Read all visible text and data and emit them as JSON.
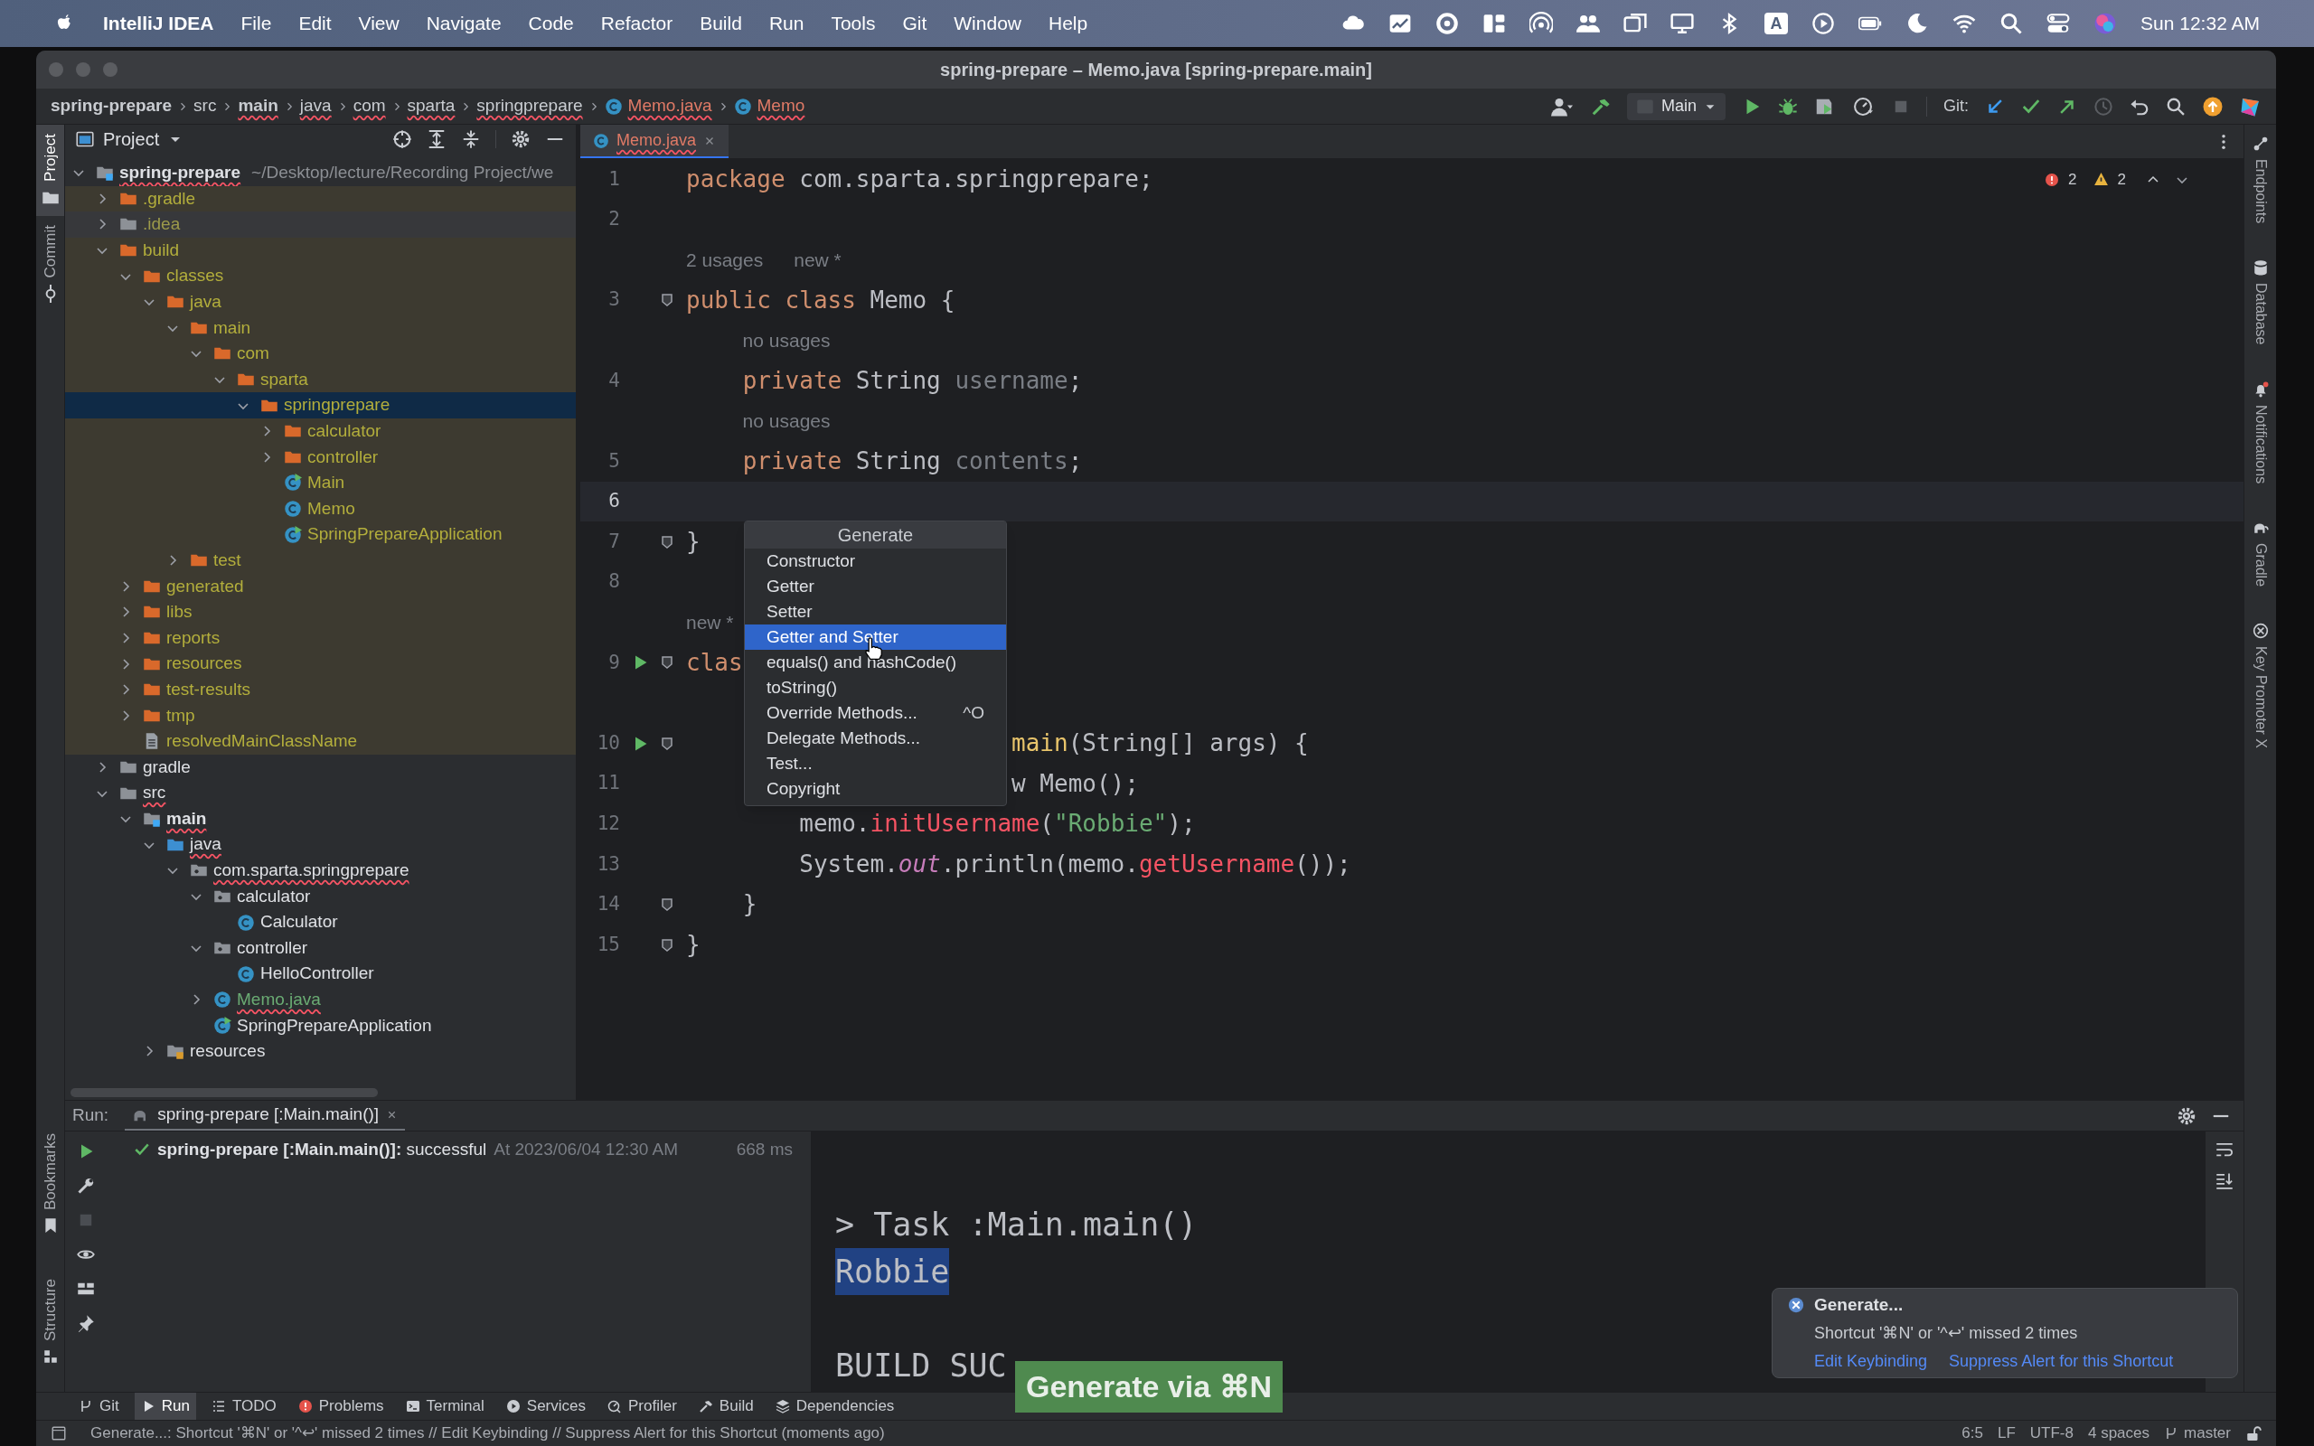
{
  "menubar": {
    "app": "IntelliJ IDEA",
    "menus": [
      "File",
      "Edit",
      "View",
      "Navigate",
      "Code",
      "Refactor",
      "Build",
      "Run",
      "Tools",
      "Git",
      "Window",
      "Help"
    ],
    "input_source": "A",
    "clock": "Sun 12:32 AM"
  },
  "window": {
    "title": "spring-prepare – Memo.java [spring-prepare.main]"
  },
  "breadcrumbs": [
    {
      "label": "spring-prepare",
      "kind": "folder",
      "bold": true,
      "error": false
    },
    {
      "label": "src",
      "kind": "folder",
      "bold": false,
      "error": false
    },
    {
      "label": "main",
      "kind": "folder",
      "bold": true,
      "error": true
    },
    {
      "label": "java",
      "kind": "folder",
      "bold": false,
      "error": true
    },
    {
      "label": "com",
      "kind": "folder",
      "bold": false,
      "error": true
    },
    {
      "label": "sparta",
      "kind": "folder",
      "bold": false,
      "error": true
    },
    {
      "label": "springprepare",
      "kind": "folder",
      "bold": false,
      "error": true
    },
    {
      "label": "Memo.java",
      "kind": "class",
      "bold": false,
      "error": true
    },
    {
      "label": "Memo",
      "kind": "class",
      "bold": false,
      "error": true
    }
  ],
  "toolbar": {
    "run_config": "Main",
    "git_label": "Git:"
  },
  "left_stripe": {
    "top": [
      {
        "label": "Project",
        "selected": true
      },
      {
        "label": "Commit",
        "selected": false
      }
    ],
    "bottom": [
      {
        "label": "Bookmarks",
        "selected": false
      },
      {
        "label": "Structure",
        "selected": false
      }
    ]
  },
  "right_stripe": [
    {
      "label": "Endpoints"
    },
    {
      "label": "Database"
    },
    {
      "label": "Notifications"
    },
    {
      "label": "Gradle"
    },
    {
      "label": "Key Promoter X"
    }
  ],
  "project": {
    "title": "Project",
    "tree": [
      {
        "label": "spring-prepare",
        "path": "~/Desktop/lecture/Recording Project/we",
        "kind": "module",
        "excluded": false,
        "expanded": true,
        "selected": false,
        "error": true,
        "children": [
          {
            "label": ".gradle",
            "kind": "folder",
            "excluded": true,
            "expanded": false,
            "selected": false,
            "error": false
          },
          {
            "label": ".idea",
            "kind": "config-folder",
            "excluded": true,
            "expanded": false,
            "selected": false,
            "error": false
          },
          {
            "label": "build",
            "kind": "folder",
            "excluded": true,
            "expanded": true,
            "selected": false,
            "error": false,
            "children": [
              {
                "label": "classes",
                "kind": "folder",
                "excluded": true,
                "expanded": true,
                "selected": false,
                "error": false,
                "children": [
                  {
                    "label": "java",
                    "kind": "folder",
                    "excluded": true,
                    "expanded": true,
                    "selected": false,
                    "error": false,
                    "children": [
                      {
                        "label": "main",
                        "kind": "folder",
                        "excluded": true,
                        "expanded": true,
                        "selected": false,
                        "error": false,
                        "children": [
                          {
                            "label": "com",
                            "kind": "folder",
                            "excluded": true,
                            "expanded": true,
                            "selected": false,
                            "error": false,
                            "children": [
                              {
                                "label": "sparta",
                                "kind": "folder",
                                "excluded": true,
                                "expanded": true,
                                "selected": false,
                                "error": false,
                                "children": [
                                  {
                                    "label": "springprepare",
                                    "kind": "folder",
                                    "excluded": true,
                                    "expanded": true,
                                    "selected": true,
                                    "error": false,
                                    "children": [
                                      {
                                        "label": "calculator",
                                        "kind": "folder",
                                        "excluded": true,
                                        "expanded": false,
                                        "selected": false,
                                        "error": false
                                      },
                                      {
                                        "label": "controller",
                                        "kind": "folder",
                                        "excluded": true,
                                        "expanded": false,
                                        "selected": false,
                                        "error": false
                                      },
                                      {
                                        "label": "Main",
                                        "kind": "class-run",
                                        "excluded": true,
                                        "selected": false,
                                        "error": false
                                      },
                                      {
                                        "label": "Memo",
                                        "kind": "class",
                                        "excluded": true,
                                        "selected": false,
                                        "error": false
                                      },
                                      {
                                        "label": "SpringPrepareApplication",
                                        "kind": "class-run",
                                        "excluded": true,
                                        "selected": false,
                                        "error": false
                                      }
                                    ]
                                  }
                                ]
                              }
                            ]
                          }
                        ]
                      },
                      {
                        "label": "test",
                        "kind": "folder",
                        "excluded": true,
                        "expanded": false,
                        "selected": false,
                        "error": false
                      }
                    ]
                  }
                ]
              },
              {
                "label": "generated",
                "kind": "folder",
                "excluded": true,
                "expanded": false,
                "selected": false,
                "error": false
              },
              {
                "label": "libs",
                "kind": "folder",
                "excluded": true,
                "expanded": false,
                "selected": false,
                "error": false
              },
              {
                "label": "reports",
                "kind": "folder",
                "excluded": true,
                "expanded": false,
                "selected": false,
                "error": false
              },
              {
                "label": "resources",
                "kind": "folder",
                "excluded": true,
                "expanded": false,
                "selected": false,
                "error": false
              },
              {
                "label": "test-results",
                "kind": "folder",
                "excluded": true,
                "expanded": false,
                "selected": false,
                "error": false
              },
              {
                "label": "tmp",
                "kind": "folder",
                "excluded": true,
                "expanded": false,
                "selected": false,
                "error": false
              },
              {
                "label": "resolvedMainClassName",
                "kind": "file",
                "excluded": true,
                "selected": false,
                "error": false
              }
            ]
          },
          {
            "label": "gradle",
            "kind": "folder",
            "excluded": false,
            "expanded": false,
            "selected": false,
            "error": false
          },
          {
            "label": "src",
            "kind": "folder",
            "excluded": false,
            "expanded": true,
            "selected": false,
            "error": true,
            "children": [
              {
                "label": "main",
                "kind": "module",
                "excluded": false,
                "expanded": true,
                "selected": false,
                "error": true,
                "children": [
                  {
                    "label": "java",
                    "kind": "source-root",
                    "excluded": false,
                    "expanded": true,
                    "selected": false,
                    "error": true,
                    "children": [
                      {
                        "label": "com.sparta.springprepare",
                        "kind": "package",
                        "excluded": false,
                        "expanded": true,
                        "selected": false,
                        "error": true,
                        "children": [
                          {
                            "label": "calculator",
                            "kind": "package",
                            "excluded": false,
                            "expanded": true,
                            "selected": false,
                            "error": false,
                            "children": [
                              {
                                "label": "Calculator",
                                "kind": "class",
                                "excluded": false,
                                "selected": false,
                                "error": false
                              }
                            ]
                          },
                          {
                            "label": "controller",
                            "kind": "package",
                            "excluded": false,
                            "expanded": true,
                            "selected": false,
                            "error": false,
                            "children": [
                              {
                                "label": "HelloController",
                                "kind": "class",
                                "excluded": false,
                                "selected": false,
                                "error": false
                              }
                            ]
                          },
                          {
                            "label": "Memo.java",
                            "kind": "modified-class",
                            "excluded": false,
                            "expanded": false,
                            "selected": false,
                            "error": true
                          },
                          {
                            "label": "SpringPrepareApplication",
                            "kind": "class-run",
                            "excluded": false,
                            "selected": false,
                            "error": false
                          }
                        ]
                      }
                    ]
                  },
                  {
                    "label": "resources",
                    "kind": "resources-root",
                    "excluded": false,
                    "expanded": false,
                    "selected": false,
                    "error": false
                  }
                ]
              }
            ]
          }
        ]
      }
    ]
  },
  "editor": {
    "tab": {
      "label": "Memo.java",
      "error": true
    },
    "problems": {
      "errors": "2",
      "warnings": "2"
    },
    "rows": [
      {
        "kind": "code",
        "number": "1",
        "run": false,
        "fold": false,
        "current": false,
        "tokens": [
          {
            "t": "package",
            "kind": "keyword"
          },
          {
            "t": " com.sparta.springprepare;",
            "kind": "plain"
          }
        ]
      },
      {
        "kind": "code",
        "number": "2",
        "run": false,
        "fold": false,
        "current": false,
        "tokens": []
      },
      {
        "kind": "hint",
        "parts": [
          "2 usages",
          "new *"
        ]
      },
      {
        "kind": "code",
        "number": "3",
        "run": false,
        "fold": true,
        "current": false,
        "tokens": [
          {
            "t": "public class",
            "kind": "keyword"
          },
          {
            "t": " Memo {",
            "kind": "plain"
          }
        ]
      },
      {
        "kind": "hint",
        "parts": [
          "no usages"
        ]
      },
      {
        "kind": "code",
        "number": "4",
        "run": false,
        "fold": false,
        "current": false,
        "tokens": [
          {
            "t": "    private",
            "kind": "keyword"
          },
          {
            "t": " String ",
            "kind": "plain"
          },
          {
            "t": "username",
            "kind": "unused"
          },
          {
            "t": ";",
            "kind": "plain"
          }
        ]
      },
      {
        "kind": "hint",
        "parts": [
          "no usages"
        ]
      },
      {
        "kind": "code",
        "number": "5",
        "run": false,
        "fold": false,
        "current": false,
        "tokens": [
          {
            "t": "    private",
            "kind": "keyword"
          },
          {
            "t": " String ",
            "kind": "plain"
          },
          {
            "t": "contents",
            "kind": "unused"
          },
          {
            "t": ";",
            "kind": "plain"
          }
        ]
      },
      {
        "kind": "code",
        "number": "6",
        "run": false,
        "fold": false,
        "current": true,
        "tokens": []
      },
      {
        "kind": "code",
        "number": "7",
        "run": false,
        "fold": true,
        "current": false,
        "tokens": [
          {
            "t": "}",
            "kind": "plain"
          }
        ]
      },
      {
        "kind": "code",
        "number": "8",
        "run": false,
        "fold": false,
        "current": false,
        "tokens": []
      },
      {
        "kind": "hint",
        "parts": [
          "new *"
        ]
      },
      {
        "kind": "code",
        "number": "9",
        "run": true,
        "fold": true,
        "current": false,
        "tokens": [
          {
            "t": "clas",
            "kind": "keyword"
          }
        ]
      },
      {
        "kind": "hidden"
      },
      {
        "kind": "code",
        "number": "10",
        "run": true,
        "fold": true,
        "current": false,
        "tokens": [
          {
            "t": "                       main",
            "kind": "declaration"
          },
          {
            "t": "(String[] args) {",
            "kind": "plain"
          }
        ]
      },
      {
        "kind": "code",
        "number": "11",
        "run": false,
        "fold": false,
        "current": false,
        "tokens": [
          {
            "t": "                       w Memo();",
            "kind": "plain"
          }
        ]
      },
      {
        "kind": "code",
        "number": "12",
        "run": false,
        "fold": false,
        "current": false,
        "tokens": [
          {
            "t": "        memo.",
            "kind": "plain"
          },
          {
            "t": "initUsername",
            "kind": "error"
          },
          {
            "t": "(",
            "kind": "plain"
          },
          {
            "t": "\"Robbie\"",
            "kind": "string"
          },
          {
            "t": ");",
            "kind": "plain"
          }
        ]
      },
      {
        "kind": "code",
        "number": "13",
        "run": false,
        "fold": false,
        "current": false,
        "tokens": [
          {
            "t": "        System.",
            "kind": "plain"
          },
          {
            "t": "out",
            "kind": "static"
          },
          {
            "t": ".println(memo.",
            "kind": "plain"
          },
          {
            "t": "getUsername",
            "kind": "error"
          },
          {
            "t": "());",
            "kind": "plain"
          }
        ]
      },
      {
        "kind": "code",
        "number": "14",
        "run": false,
        "fold": true,
        "current": false,
        "tokens": [
          {
            "t": "    }",
            "kind": "plain"
          }
        ]
      },
      {
        "kind": "code",
        "number": "15",
        "run": false,
        "fold": true,
        "current": false,
        "tokens": [
          {
            "t": "}",
            "kind": "plain"
          }
        ]
      }
    ]
  },
  "generate_popup": {
    "title": "Generate",
    "items": [
      {
        "label": "Constructor",
        "selected": false
      },
      {
        "label": "Getter",
        "selected": false
      },
      {
        "label": "Setter",
        "selected": false
      },
      {
        "label": "Getter and Setter",
        "selected": true
      },
      {
        "label": "equals() and hashCode()",
        "selected": false
      },
      {
        "label": "toString()",
        "selected": false
      },
      {
        "label": "Override Methods...",
        "shortcut": "^O",
        "selected": false
      },
      {
        "label": "Delegate Methods...",
        "selected": false
      },
      {
        "label": "Test...",
        "selected": false
      },
      {
        "label": "Copyright",
        "selected": false
      }
    ]
  },
  "run_panel": {
    "label": "Run:",
    "tab": "spring-prepare [:Main.main()]",
    "result": {
      "name": "spring-prepare [:Main.main()]:",
      "status": "successful",
      "time": "At 2023/06/04 12:30 AM",
      "duration": "668 ms"
    },
    "console": [
      {
        "kind": "line",
        "text": "> Task :Main.main()",
        "selected": false
      },
      {
        "kind": "line",
        "text": "Robbie",
        "selected": true
      },
      {
        "kind": "blank"
      },
      {
        "kind": "line",
        "text": "BUILD SUC",
        "selected": false
      }
    ]
  },
  "key_promoter": "Generate via ⌘N",
  "notification": {
    "title": "Generate...",
    "message": "Shortcut '⌘N' or '^↩' missed 2 times",
    "links": [
      "Edit Keybinding",
      "Suppress Alert for this Shortcut"
    ]
  },
  "tool_windows": [
    {
      "label": "Git",
      "selected": false
    },
    {
      "label": "Run",
      "selected": true
    },
    {
      "label": "TODO",
      "selected": false
    },
    {
      "label": "Problems",
      "selected": false
    },
    {
      "label": "Terminal",
      "selected": false
    },
    {
      "label": "Services",
      "selected": false
    },
    {
      "label": "Profiler",
      "selected": false
    },
    {
      "label": "Build",
      "selected": false
    },
    {
      "label": "Dependencies",
      "selected": false
    }
  ],
  "status_bar": {
    "message": "Generate...: Shortcut '⌘N' or '^↩' missed 2 times // Edit Keybinding // Suppress Alert for this Shortcut (moments ago)",
    "position": "6:5",
    "line_separator": "LF",
    "encoding": "UTF-8",
    "indent": "4 spaces",
    "branch": "master"
  }
}
